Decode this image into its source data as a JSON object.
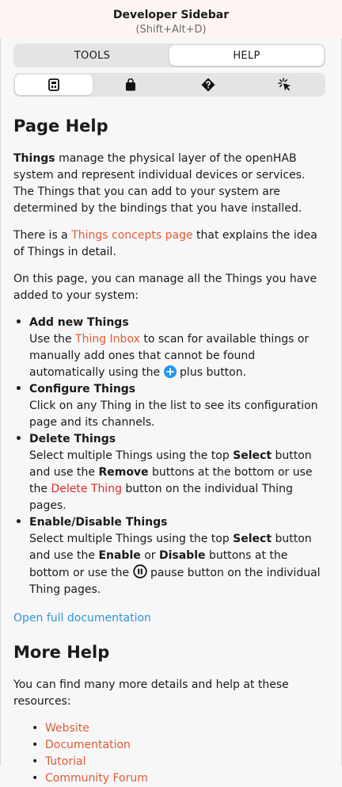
{
  "header": {
    "title": "Developer Sidebar",
    "shortcut": "(Shift+Alt+D)"
  },
  "tabs": [
    {
      "label": "TOOLS",
      "active": false
    },
    {
      "label": "HELP",
      "active": true
    }
  ],
  "icon_tabs": [
    {
      "icon": "page-help-icon",
      "active": true
    },
    {
      "icon": "shopping-bag-icon",
      "active": false
    },
    {
      "icon": "question-diamond-icon",
      "active": false
    },
    {
      "icon": "click-cursor-icon",
      "active": false
    }
  ],
  "page_help": {
    "heading": "Page Help",
    "p1": {
      "bold": "Things",
      "text": " manage the physical layer of the openHAB system and represent individual devices or services. The Things that you can add to your system are determined by the bindings that you have installed."
    },
    "p2": {
      "pre": "There is a ",
      "link": "Things concepts page",
      "post": " that explains the idea of Things in detail."
    },
    "p3": "On this page, you can manage all the Things you have added to your system:",
    "items": {
      "add": {
        "title": "Add new Things",
        "t1": "Use the ",
        "link": "Thing Inbox",
        "t2": " to scan for available things or manually add ones that cannot be found automatically using the ",
        "t3": " plus button."
      },
      "configure": {
        "title": "Configure Things",
        "text": "Click on any Thing in the list to see its configuration page and its channels."
      },
      "delete": {
        "title": "Delete Things",
        "t1": "Select multiple Things using the top ",
        "b1": "Select",
        "t2": " button and use the ",
        "b2": "Remove",
        "t3": " buttons at the bottom or use the ",
        "link": "Delete Thing",
        "t4": " button on the individual Thing pages."
      },
      "enable": {
        "title": "Enable/Disable Things",
        "t1": "Select multiple Things using the top ",
        "b1": "Select",
        "t2": " button and use the ",
        "b2": "Enable",
        "t3": " or ",
        "b3": "Disable",
        "t4": " buttons at the bottom or use the ",
        "t5": " pause button on the individual Thing pages."
      }
    },
    "doc_link": "Open full documentation"
  },
  "more_help": {
    "heading": "More Help",
    "intro": "You can find many more details and help at these resources:",
    "links": [
      "Website",
      "Documentation",
      "Tutorial",
      "Community Forum"
    ]
  },
  "colors": {
    "link": "#e05c33",
    "danger": "#e5292c",
    "doc_link": "#2f96d6",
    "plus": "#2196f3"
  }
}
